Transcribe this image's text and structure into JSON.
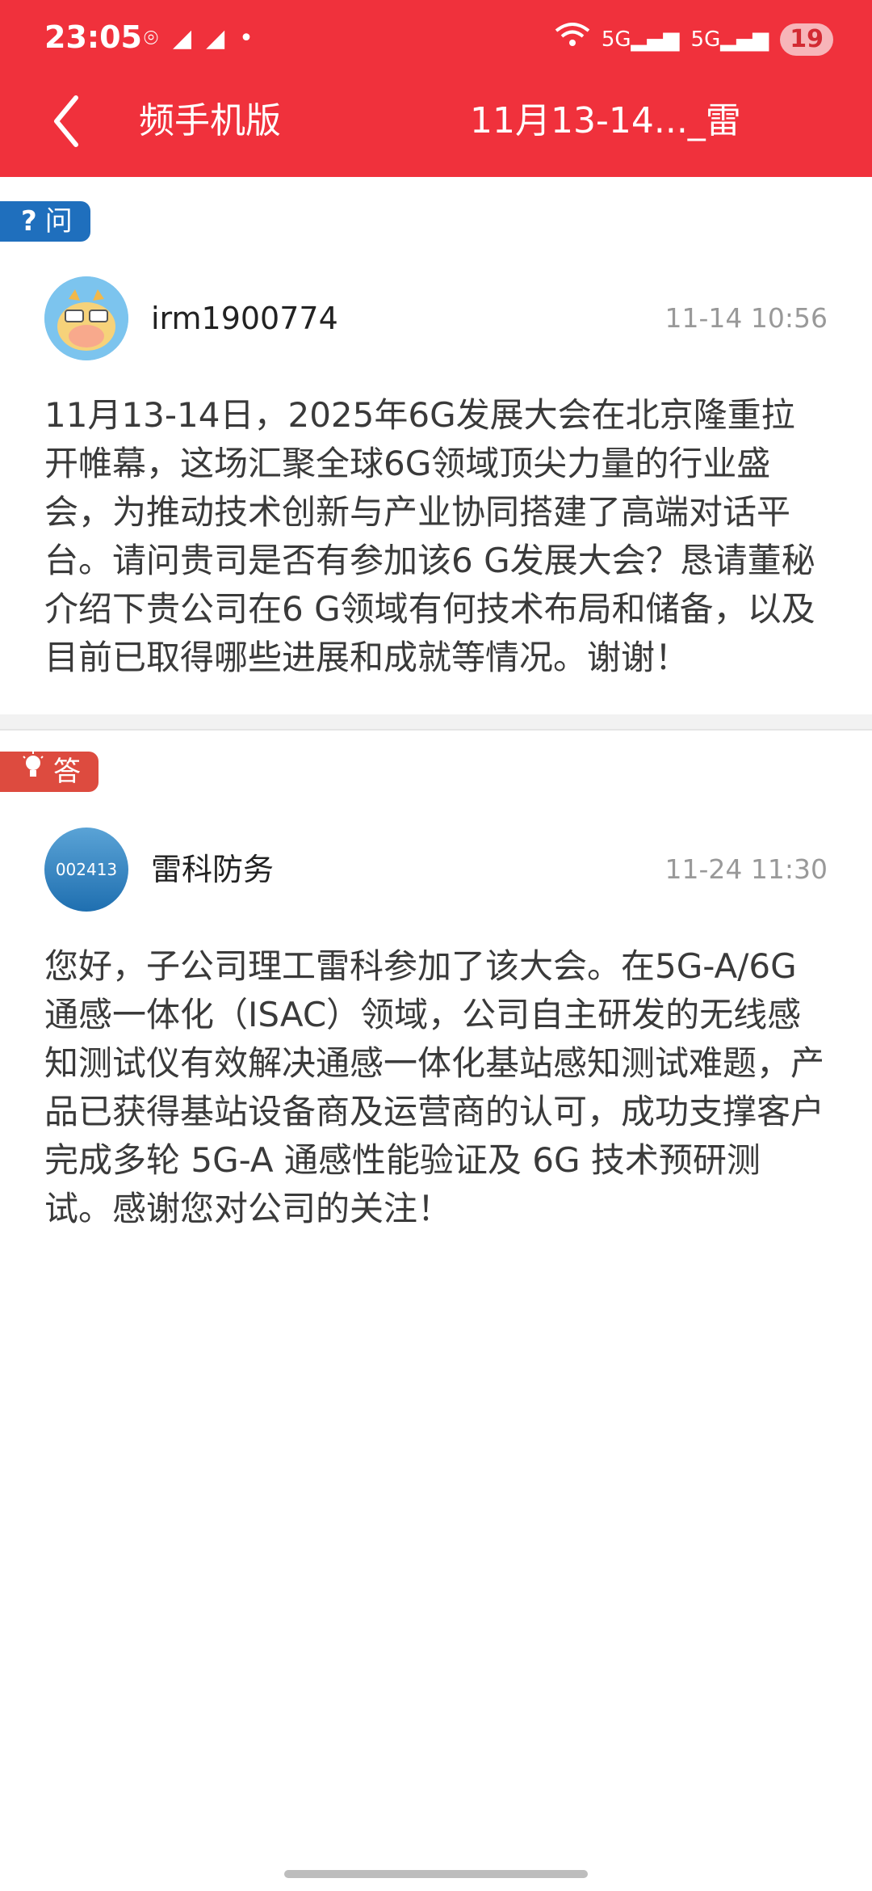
{
  "status_bar": {
    "time": "23:05",
    "signal_1": "5G",
    "signal_2": "5G",
    "battery": "19"
  },
  "nav": {
    "left_title": "频手机版",
    "center_title": "11月13-14..._雷"
  },
  "question": {
    "tag_icon": "?",
    "tag_label": "问",
    "author": "irm1900774",
    "time": "11-14 10:56",
    "content": "11月13-14日，2025年6G发展大会在北京隆重拉开帷幕，这场汇聚全球6G领域顶尖力量的行业盛会，为推动技术创新与产业协同搭建了高端对话平台。请问贵司是否有参加该6 G发展大会？恳请董秘介绍下贵公司在6 G领域有何技术布局和储备，以及目前已取得哪些进展和成就等情况。谢谢！"
  },
  "answer": {
    "tag_label": "答",
    "avatar_code": "002413",
    "author": "雷科防务",
    "time": "11-24 11:30",
    "content": "您好，子公司理工雷科参加了该大会。在5G-A/6G通感一体化（ISAC）领域，公司自主研发的无线感知测试仪有效解决通感一体化基站感知测试难题，产品已获得基站设备商及运营商的认可，成功支撑客户完成多轮 5G-A 通感性能验证及 6G 技术预研测试。感谢您对公司的关注！"
  },
  "colors": {
    "header": "#f0313c",
    "question_tag": "#1f6fbd",
    "answer_tag": "#dd4b3f"
  }
}
